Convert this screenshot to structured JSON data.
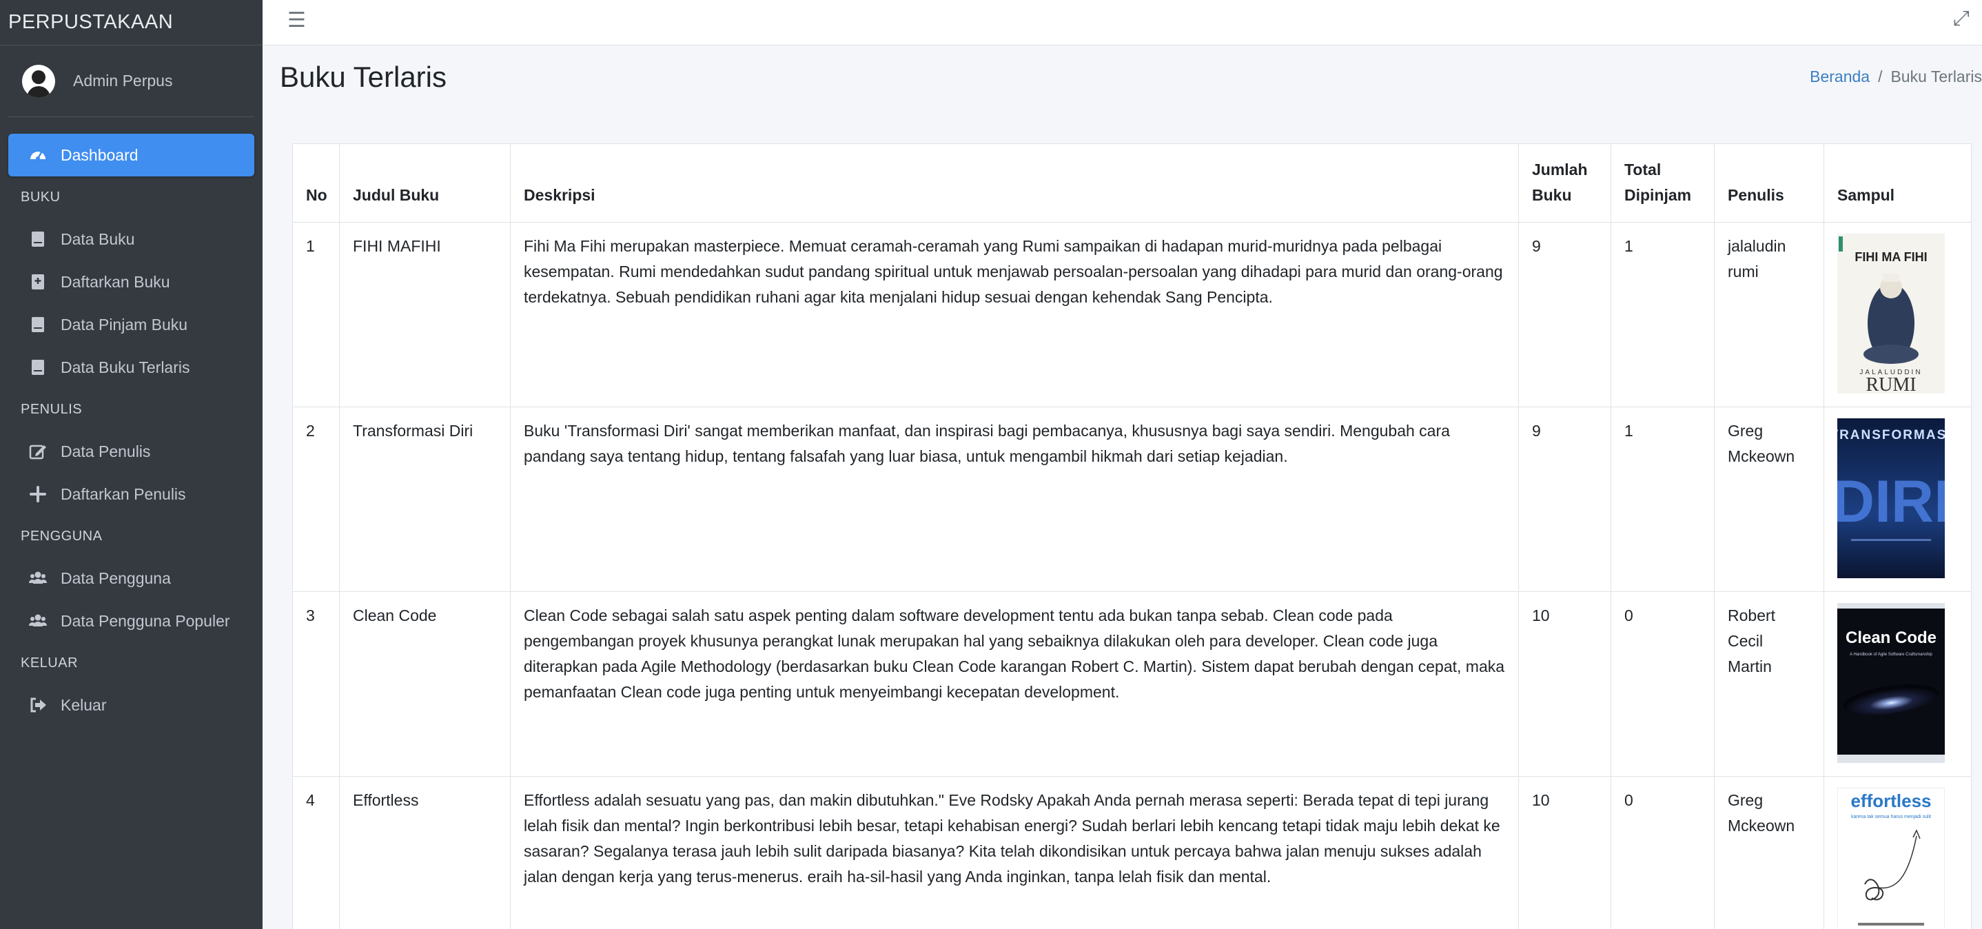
{
  "brand": "PERPUSTAKAAN",
  "user": {
    "name": "Admin Perpus"
  },
  "sidebar": {
    "dashboard": "Dashboard",
    "sections": [
      {
        "header": "BUKU",
        "items": [
          "Data Buku",
          "Daftarkan Buku",
          "Data Pinjam Buku",
          "Data Buku Terlaris"
        ]
      },
      {
        "header": "PENULIS",
        "items": [
          "Data Penulis",
          "Daftarkan Penulis"
        ]
      },
      {
        "header": "PENGGUNA",
        "items": [
          "Data Pengguna",
          "Data Pengguna Populer"
        ]
      },
      {
        "header": "KELUAR",
        "items": [
          "Keluar"
        ]
      }
    ]
  },
  "page": {
    "title": "Buku Terlaris"
  },
  "breadcrumb": {
    "home": "Beranda",
    "current": "Buku Terlaris"
  },
  "table": {
    "headers": {
      "no": "No",
      "judul": "Judul Buku",
      "deskripsi": "Deskripsi",
      "jumlah_line1": "Jumlah",
      "jumlah_line2": "Buku",
      "total_line1": "Total",
      "total_line2": "Dipinjam",
      "penulis": "Penulis",
      "sampul": "Sampul"
    },
    "rows": [
      {
        "no": "1",
        "judul": "FIHI MAFIHI",
        "deskripsi": "Fihi Ma Fihi merupakan masterpiece. Memuat ceramah-ceramah yang Rumi sampaikan di hadapan murid-muridnya pada pelbagai kesempatan. Rumi mendedahkan sudut pandang spiritual untuk menjawab persoalan-persoalan yang dihadapi para murid dan orang-orang terdekatnya. Sebuah pendidikan ruhani agar kita menjalani hidup sesuai dengan kehendak Sang Pencipta.",
        "jumlah": "9",
        "dipinjam": "1",
        "penulis": "jalaludin rumi",
        "cover": {
          "title": "FIHI MA FIHI",
          "author": "RUMI",
          "top_text": "JALALUDDIN"
        }
      },
      {
        "no": "2",
        "judul": "Transformasi Diri",
        "deskripsi": "Buku 'Transformasi Diri' sangat memberikan manfaat, dan inspirasi bagi pembacanya, khususnya bagi saya sendiri. Mengubah cara pandang saya tentang hidup, tentang falsafah yang luar biasa, untuk mengambil hikmah dari setiap kejadian.",
        "jumlah": "9",
        "dipinjam": "1",
        "penulis": "Greg Mckeown",
        "cover": {
          "title": "TRANSFORMASI",
          "big": "DIRI"
        }
      },
      {
        "no": "3",
        "judul": "Clean Code",
        "deskripsi": "Clean Code sebagai salah satu aspek penting dalam software development tentu ada bukan tanpa sebab. Clean code pada pengembangan proyek khusunya perangkat lunak merupakan hal yang sebaiknya dilakukan oleh para developer. Clean code juga diterapkan pada Agile Methodology (berdasarkan buku Clean Code karangan Robert C. Martin). Sistem dapat berubah dengan cepat, maka pemanfaatan Clean code juga penting untuk menyeimbangi kecepatan development.",
        "jumlah": "10",
        "dipinjam": "0",
        "penulis": "Robert Cecil Martin",
        "cover": {
          "title": "Clean Code",
          "subtitle": "A Handbook of Agile Software Craftsmanship"
        }
      },
      {
        "no": "4",
        "judul": "Effortless",
        "deskripsi": "Effortless adalah sesuatu yang pas, dan makin dibutuhkan.\" Eve Rodsky Apakah Anda pernah merasa seperti: Berada tepat di tepi jurang lelah fisik dan mental? Ingin berkontribusi lebih besar, tetapi kehabisan energi? Sudah berlari lebih kencang tetapi tidak maju lebih dekat ke sasaran? Segalanya terasa jauh lebih sulit daripada biasanya? Kita telah dikondisikan untuk percaya bahwa jalan menuju sukses adalah jalan dengan kerja yang terus-menerus. eraih ha-sil-hasil yang Anda inginkan, tanpa lelah fisik dan mental.",
        "jumlah": "10",
        "dipinjam": "0",
        "penulis": "Greg Mckeown",
        "cover": {
          "title": "effortless",
          "subtitle": "karena tak semua harus menjadi sulit"
        }
      }
    ]
  }
}
